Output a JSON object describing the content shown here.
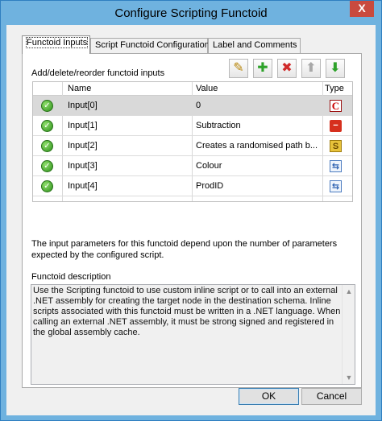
{
  "window": {
    "title": "Configure Scripting Functoid",
    "close_glyph": "X"
  },
  "tabs": [
    {
      "label": "Functoid Inputs"
    },
    {
      "label": "Script Functoid Configuration"
    },
    {
      "label": "Label and Comments"
    }
  ],
  "inputs": {
    "label": "Add/delete/reorder functoid inputs",
    "toolbar_icons": [
      "pencil-icon",
      "add-icon",
      "delete-icon",
      "move-up-icon",
      "move-down-icon"
    ],
    "columns": {
      "name": "Name",
      "value": "Value",
      "type": "Type"
    },
    "rows": [
      {
        "name": "Input[0]",
        "value": "0",
        "type_icon": "constant-icon",
        "type_glyph": "C"
      },
      {
        "name": "Input[1]",
        "value": "Subtraction",
        "type_icon": "functoid-link-icon",
        "type_glyph": "−"
      },
      {
        "name": "Input[2]",
        "value": "Creates a randomised path b...",
        "type_icon": "scripting-functoid-icon",
        "type_glyph": "S"
      },
      {
        "name": "Input[3]",
        "value": "Colour",
        "type_icon": "schema-node-icon",
        "type_glyph": "⇆"
      },
      {
        "name": "Input[4]",
        "value": "ProdID",
        "type_icon": "schema-node-icon",
        "type_glyph": "⇆"
      }
    ]
  },
  "info_text": "The input parameters for this functoid depend upon the number of parameters expected by the configured script.",
  "description": {
    "label": "Functoid description",
    "text": "Use the Scripting functoid to use custom inline script or to call into an external .NET assembly for creating the target node in the destination schema. Inline scripts associated with this functoid must be written in a .NET language. When calling an external .NET assembly, it must be strong signed and registered in the global assembly cache."
  },
  "buttons": {
    "ok": "OK",
    "cancel": "Cancel"
  },
  "colors": {
    "titlebar": "#6fb2df",
    "close": "#c94a3e",
    "selected_row": "#d9d9d9"
  }
}
